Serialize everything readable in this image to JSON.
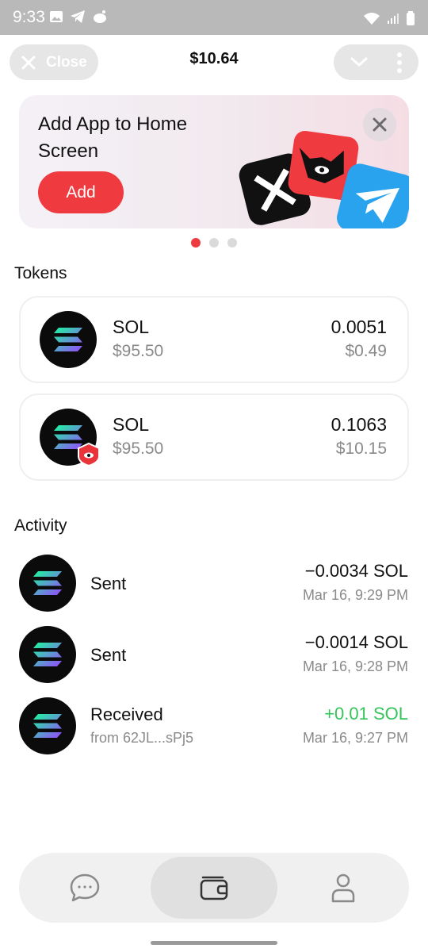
{
  "status_bar": {
    "time": "9:33"
  },
  "header": {
    "close_label": "Close",
    "balance": "$10.64"
  },
  "banner": {
    "title": "Add App to Home Screen",
    "add_label": "Add"
  },
  "sections": {
    "tokens": "Tokens",
    "activity": "Activity"
  },
  "tokens": [
    {
      "name": "SOL",
      "price": "$95.50",
      "amount": "0.0051",
      "value": "$0.49",
      "icon": "solana-icon"
    },
    {
      "name": "SOL",
      "price": "$95.50",
      "amount": "0.1063",
      "value": "$10.15",
      "icon": "solana-icon",
      "badge": "shield-eye-badge-icon"
    }
  ],
  "activity": [
    {
      "label": "Sent",
      "sub": "",
      "amount": "−0.0034 SOL",
      "time": "Mar 16, 9:29 PM"
    },
    {
      "label": "Sent",
      "sub": "",
      "amount": "−0.0014 SOL",
      "time": "Mar 16, 9:28 PM"
    },
    {
      "label": "Received",
      "sub": "from 62JL...sPj5",
      "amount": "+0.01 SOL",
      "time": "Mar 16, 9:27 PM"
    }
  ],
  "carousel": {
    "count": 3,
    "active": 0
  },
  "colors": {
    "accent": "#ef3a3f",
    "positive": "#34c45a",
    "muted": "#8a8a8a"
  },
  "nav": [
    {
      "icon": "chat-icon",
      "active": false
    },
    {
      "icon": "wallet-icon",
      "active": true
    },
    {
      "icon": "profile-icon",
      "active": false
    }
  ]
}
